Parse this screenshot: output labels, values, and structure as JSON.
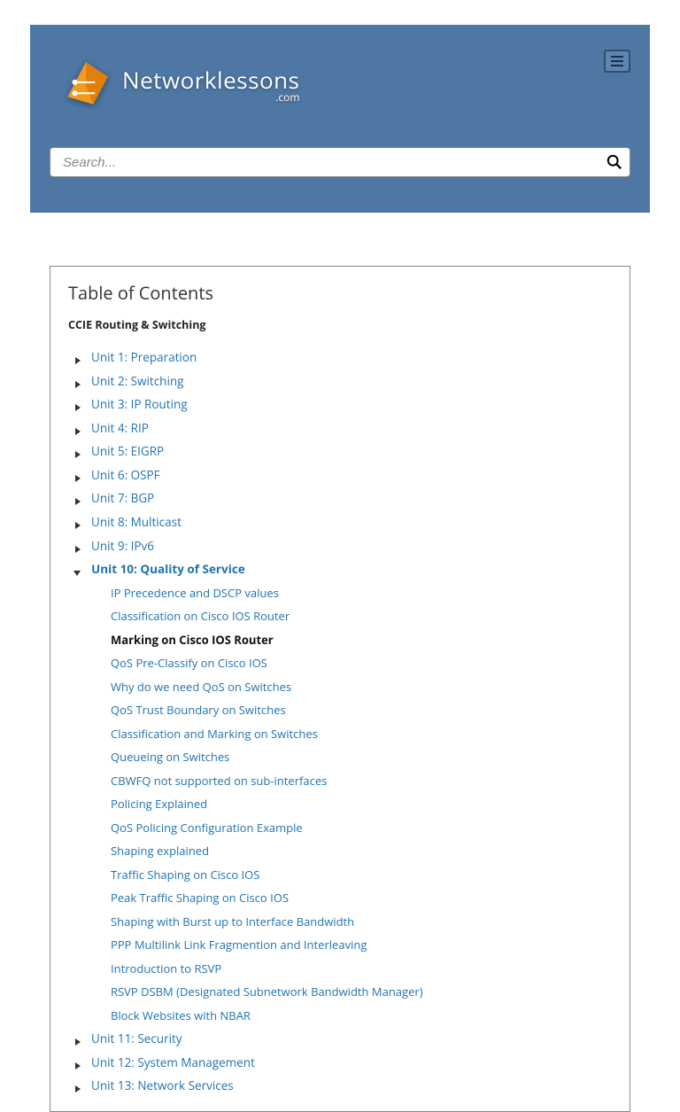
{
  "brand": {
    "name": "Networklessons",
    "suffix": ".com"
  },
  "search": {
    "placeholder": "Search..."
  },
  "toc": {
    "title": "Table of Contents",
    "subtitle": "CCIE Routing & Switching",
    "units": [
      {
        "label": "Unit 1: Preparation",
        "expanded": false
      },
      {
        "label": "Unit 2: Switching",
        "expanded": false
      },
      {
        "label": "Unit 3: IP Routing",
        "expanded": false
      },
      {
        "label": "Unit 4: RIP",
        "expanded": false
      },
      {
        "label": "Unit 5: EIGRP",
        "expanded": false
      },
      {
        "label": "Unit 6: OSPF",
        "expanded": false
      },
      {
        "label": "Unit 7: BGP",
        "expanded": false
      },
      {
        "label": "Unit 8: Multicast",
        "expanded": false
      },
      {
        "label": "Unit 9: IPv6",
        "expanded": false
      },
      {
        "label": "Unit 10: Quality of Service",
        "expanded": true,
        "active": true,
        "children": [
          {
            "label": "IP Precedence and DSCP values"
          },
          {
            "label": "Classification on Cisco IOS Router"
          },
          {
            "label": "Marking on Cisco IOS Router",
            "current": true
          },
          {
            "label": "QoS Pre-Classify on Cisco IOS"
          },
          {
            "label": "Why do we need QoS on Switches"
          },
          {
            "label": "QoS Trust Boundary on Switches"
          },
          {
            "label": "Classification and Marking on Switches"
          },
          {
            "label": "Queueing on Switches"
          },
          {
            "label": "CBWFQ not supported on sub-interfaces"
          },
          {
            "label": "Policing Explained"
          },
          {
            "label": "QoS Policing Configuration Example"
          },
          {
            "label": "Shaping explained"
          },
          {
            "label": "Traffic Shaping on Cisco IOS"
          },
          {
            "label": "Peak Traffic Shaping on Cisco IOS"
          },
          {
            "label": "Shaping with Burst up to Interface Bandwidth"
          },
          {
            "label": "PPP Multilink Link Fragmention and Interleaving"
          },
          {
            "label": "Introduction to RSVP"
          },
          {
            "label": "RSVP DSBM (Designated Subnetwork Bandwidth Manager)"
          },
          {
            "label": "Block Websites with NBAR"
          }
        ]
      },
      {
        "label": "Unit 11: Security",
        "expanded": false
      },
      {
        "label": "Unit 12: System Management",
        "expanded": false
      },
      {
        "label": "Unit 13: Network Services",
        "expanded": false
      }
    ]
  }
}
